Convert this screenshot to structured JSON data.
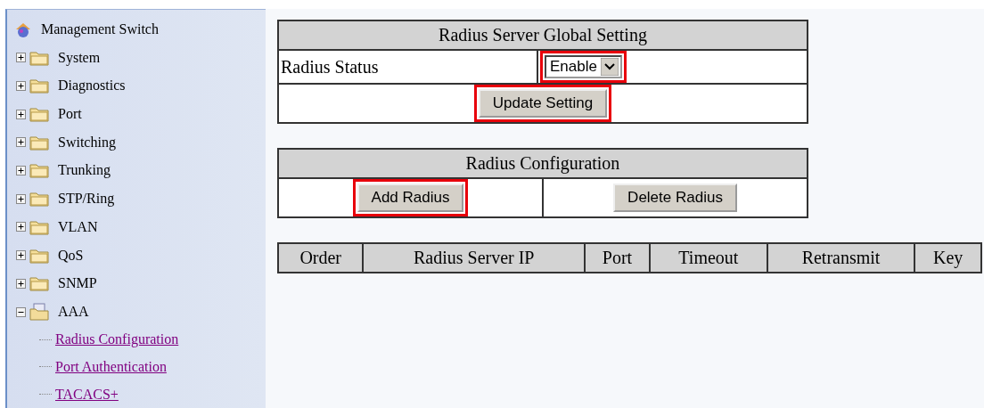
{
  "sidebar": {
    "root": "Management Switch",
    "items": [
      {
        "label": "System",
        "expanded": false
      },
      {
        "label": "Diagnostics",
        "expanded": false
      },
      {
        "label": "Port",
        "expanded": false
      },
      {
        "label": "Switching",
        "expanded": false
      },
      {
        "label": "Trunking",
        "expanded": false
      },
      {
        "label": "STP/Ring",
        "expanded": false
      },
      {
        "label": "VLAN",
        "expanded": false
      },
      {
        "label": "QoS",
        "expanded": false
      },
      {
        "label": "SNMP",
        "expanded": false
      },
      {
        "label": "AAA",
        "expanded": true,
        "children": [
          {
            "label": "Radius Configuration"
          },
          {
            "label": "Port Authentication"
          },
          {
            "label": "TACACS+"
          }
        ]
      }
    ]
  },
  "global_setting": {
    "title": "Radius Server Global Setting",
    "status_label": "Radius Status",
    "status_select": {
      "value": "Enable",
      "highlighted": true
    },
    "update_button": {
      "label": "Update Setting",
      "highlighted": true
    }
  },
  "radius_configuration": {
    "title": "Radius Configuration",
    "buttons": [
      {
        "label": "Add Radius",
        "highlighted": true
      },
      {
        "label": "Delete Radius",
        "highlighted": false
      }
    ]
  },
  "server_table": {
    "columns": [
      "Order",
      "Radius Server IP",
      "Port",
      "Timeout",
      "Retransmit",
      "Key"
    ]
  }
}
